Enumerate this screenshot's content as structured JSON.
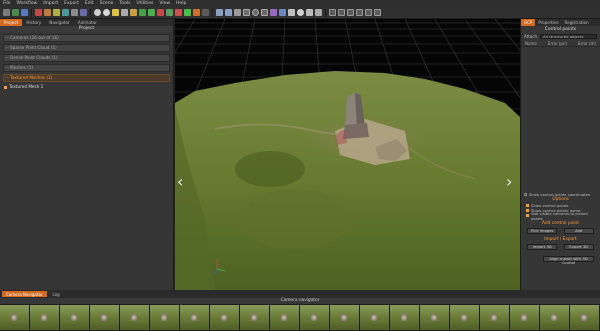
{
  "menu": [
    "File",
    "Workflow",
    "Import",
    "Export",
    "Edit",
    "Scene",
    "Tools",
    "Utilities",
    "View",
    "Help"
  ],
  "left_panel": {
    "tabs": [
      "Project",
      "History",
      "Navigator",
      "Animator"
    ],
    "title": "Project",
    "items": [
      {
        "label": "Cameras (16 out of 16)",
        "active": false
      },
      {
        "label": "Sparse Point Cloud (1)",
        "active": false
      },
      {
        "label": "Dense Point Clouds (1)",
        "active": false
      },
      {
        "label": "Meshes (1)",
        "active": false
      },
      {
        "label": "Textured Meshes (1)",
        "active": true
      }
    ],
    "subitem": "Textured Mesh 1"
  },
  "right_panel": {
    "tabs": [
      "GCP",
      "Properties",
      "Registration"
    ],
    "title": "Control points",
    "attach_label": "Attach",
    "attach_value": "All structured objects",
    "columns": [
      "Name",
      "Error (px)",
      "Error (m)"
    ],
    "show_coords": "Show control points coordinates",
    "options_title": "Options",
    "opt_show_points": "Show control points",
    "opt_show_names": "Show control points name",
    "opt_add_visible": "Add visible cameras to picked points",
    "add_title": "Add control point",
    "pick_images": "Pick images",
    "add_button": "Add",
    "import_title": "Import / Export",
    "import_button": "Import 3D",
    "export_button": "Export 3D",
    "align_button": "Align model with 3D Control"
  },
  "bottom": {
    "tabs": [
      "Camera Navigator",
      "Log"
    ],
    "title": "Camera navigator",
    "thumb_count": 20
  },
  "colors": {
    "accent": "#d2691e",
    "highlight": "#ff9a3c",
    "panel": "#363636"
  }
}
